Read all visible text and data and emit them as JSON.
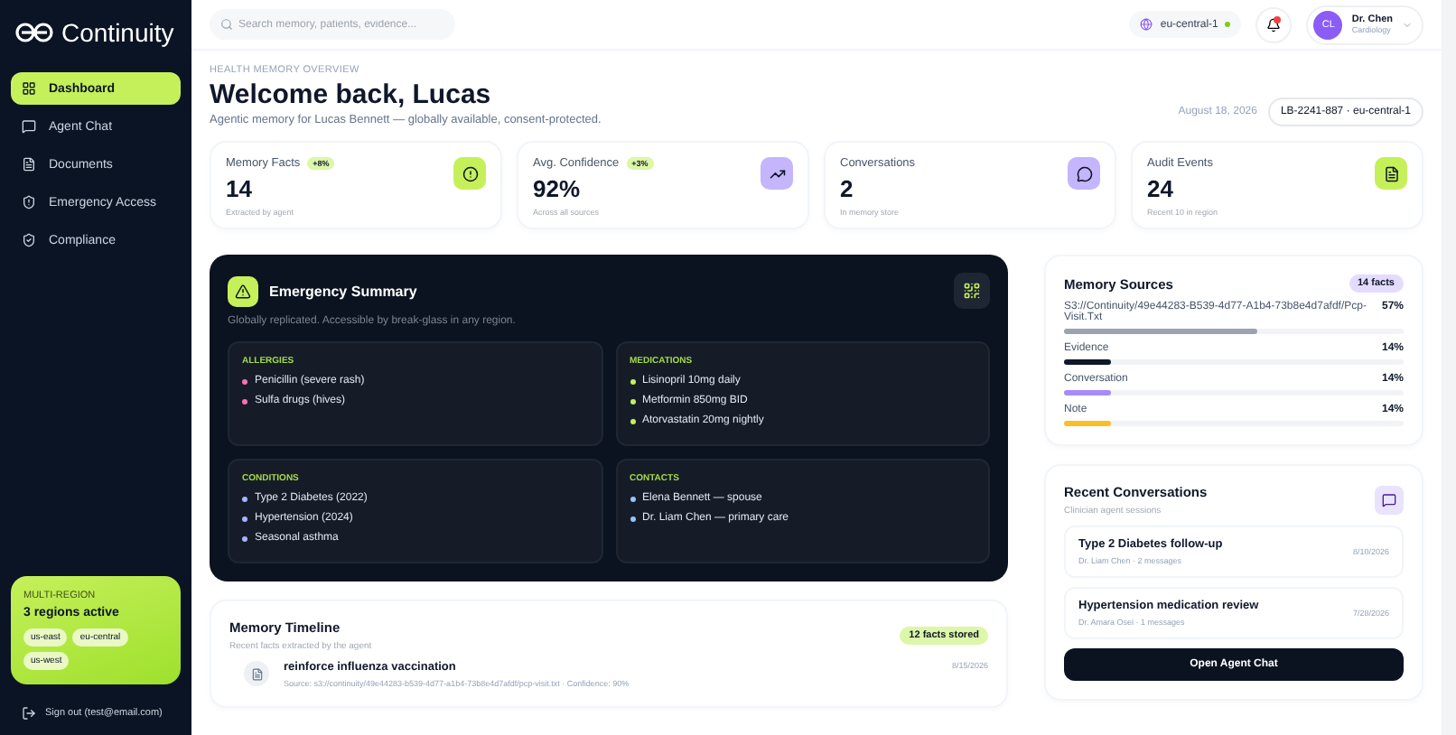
{
  "brand": {
    "name": "Continuity"
  },
  "sidebar": {
    "items": [
      {
        "label": "Dashboard",
        "kind": "grid",
        "selected": true
      },
      {
        "label": "Agent Chat",
        "kind": "chat",
        "selected": false
      },
      {
        "label": "Documents",
        "kind": "doc",
        "selected": false
      },
      {
        "label": "Emergency Access",
        "kind": "alert",
        "selected": false
      },
      {
        "label": "Compliance",
        "kind": "check",
        "selected": false
      }
    ],
    "region_card": {
      "label": "MULTI-REGION",
      "title": "3 regions active",
      "regions": [
        "us-east",
        "eu-central",
        "us-west"
      ]
    },
    "sign_out": "Sign out (test@email.com)"
  },
  "topbar": {
    "search": {
      "placeholder": "Search memory, patients, evidence..."
    },
    "region": "eu-central-1",
    "notifications_unread": true,
    "user": {
      "initials": "CL",
      "name": "Dr. Chen",
      "role": "Cardiology"
    }
  },
  "header": {
    "eyebrow": "HEALTH MEMORY OVERVIEW",
    "title": "Welcome back, Lucas",
    "subtitle": "Agentic memory for Lucas Bennett — globally available, consent-protected.",
    "date": "August 18, 2026",
    "record": "LB-2241-887 · eu-central-1"
  },
  "stats": [
    {
      "label": "Memory Facts",
      "badge": "+8%",
      "value": "14",
      "note": "Extracted by agent",
      "kind": "alert",
      "color": "#c5f05a"
    },
    {
      "label": "Avg. Confidence",
      "badge": "+3%",
      "value": "92%",
      "note": "Across all sources",
      "kind": "trend",
      "color": "#c4b5fd"
    },
    {
      "label": "Conversations",
      "value": "2",
      "note": "In memory store",
      "kind": "chat",
      "color": "#c4b5fd"
    },
    {
      "label": "Audit Events",
      "value": "24",
      "note": "Recent 10 in region",
      "kind": "doc",
      "color": "#c5f05a"
    }
  ],
  "emergency": {
    "title": "Emergency Summary",
    "subtitle": "Globally replicated. Accessible by break-glass in any region.",
    "sections": [
      {
        "title": "ALLERGIES",
        "color": "#f472b6",
        "items": [
          "Penicillin (severe rash)",
          "Sulfa drugs (hives)"
        ]
      },
      {
        "title": "MEDICATIONS",
        "color": "#c5f05a",
        "items": [
          "Lisinopril 10mg daily",
          "Metformin 850mg BID",
          "Atorvastatin 20mg nightly"
        ]
      },
      {
        "title": "CONDITIONS",
        "color": "#a5b4fc",
        "items": [
          "Type 2 Diabetes (2022)",
          "Hypertension (2024)",
          "Seasonal asthma"
        ]
      },
      {
        "title": "CONTACTS",
        "color": "#93c5fd",
        "items": [
          "Elena Bennett — spouse",
          "Dr. Liam Chen — primary care"
        ]
      }
    ]
  },
  "timeline": {
    "title": "Memory Timeline",
    "subtitle": "Recent facts extracted by the agent",
    "badge": "12 facts stored",
    "items": [
      {
        "title": "reinforce influenza vaccination",
        "meta": "Source: s3://continuity/49e44283-b539-4d77-a1b4-73b8e4d7afdf/pcp-visit.txt · Confidence: 90%",
        "date": "8/15/2026"
      }
    ]
  },
  "sources": {
    "title": "Memory Sources",
    "badge": "14 facts",
    "items": [
      {
        "name": "S3://Continuity/49e44283-B539-4d77-A1b4-73b8e4d7afdf/Pcp-Visit.Txt",
        "reading": "57%",
        "level": 0.57,
        "color": "#9ca3af"
      },
      {
        "name": "Evidence",
        "reading": "14%",
        "level": 0.14,
        "color": "#0f172a"
      },
      {
        "name": "Conversation",
        "reading": "14%",
        "level": 0.14,
        "color": "#a78bfa"
      },
      {
        "name": "Note",
        "reading": "14%",
        "level": 0.14,
        "color": "#fbbf24"
      }
    ]
  },
  "conversations": {
    "title": "Recent Conversations",
    "subtitle": "Clinician agent sessions",
    "items": [
      {
        "title": "Type 2 Diabetes follow-up",
        "meta": "Dr. Liam Chen · 2 messages",
        "date": "8/10/2026"
      },
      {
        "title": "Hypertension medication review",
        "meta": "Dr. Amara Osei · 1 messages",
        "date": "7/28/2026"
      }
    ],
    "button": "Open Agent Chat"
  }
}
